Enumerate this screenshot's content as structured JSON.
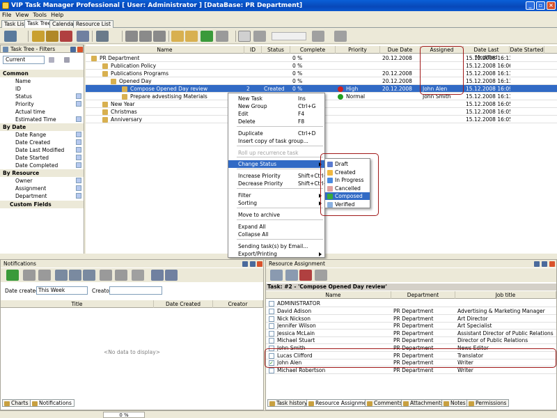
{
  "window": {
    "title": "VIP Task Manager Professional [ User: Administrator ] [DataBase: PR Department]"
  },
  "menu": [
    "File",
    "View",
    "Tools",
    "Help"
  ],
  "main_tabs": [
    "Task List",
    "Task Tree",
    "Calendar",
    "Resource List"
  ],
  "filters": {
    "title": "Task Tree - Filters",
    "current": "Current",
    "sections": [
      {
        "label": "Common",
        "items": [
          "Name",
          "ID",
          "Status",
          "Priority",
          "Actual time",
          "Estimated Time"
        ]
      },
      {
        "label": "By Date",
        "items": [
          "Date Range",
          "Date Created",
          "Date Last Modified",
          "Date Started",
          "Date Completed"
        ]
      },
      {
        "label": "By Resource",
        "items": [
          "Owner",
          "Assignment",
          "Department"
        ]
      }
    ],
    "custom": "Custom Fields"
  },
  "tree": {
    "columns": [
      "Name",
      "ID",
      "Status",
      "Complete",
      "Priority",
      "Due Date",
      "Assigned",
      "Date Last Modified",
      "Date Started"
    ],
    "rows": [
      {
        "name": "PR Department",
        "id": "",
        "status": "",
        "complete": "0 %",
        "priority": "",
        "due": "20.12.2008",
        "assigned": "",
        "modified": "15.12.2008 16:13"
      },
      {
        "name": "Publication Policy",
        "id": "",
        "status": "",
        "complete": "0 %",
        "priority": "",
        "due": "",
        "assigned": "",
        "modified": "15.12.2008 16:06"
      },
      {
        "name": "Publications Programs",
        "id": "",
        "status": "",
        "complete": "0 %",
        "priority": "",
        "due": "20.12.2008",
        "assigned": "",
        "modified": "15.12.2008 16:13"
      },
      {
        "name": "Opened Day",
        "id": "",
        "status": "",
        "complete": "0 %",
        "priority": "",
        "due": "20.12.2008",
        "assigned": "",
        "modified": "15.12.2008 16:13"
      },
      {
        "name": "Compose Opened Day review",
        "id": "2",
        "status": "Created",
        "complete": "0 %",
        "priority": "High",
        "due": "20.12.2008",
        "assigned": "John Alen",
        "modified": "15.12.2008 16:09"
      },
      {
        "name": "Prepare advestising Materials",
        "id": "",
        "status": "",
        "complete": "",
        "priority": "Normal",
        "due": "",
        "assigned": "John Smith",
        "modified": "15.12.2008 16:13"
      },
      {
        "name": "New Year",
        "id": "",
        "status": "",
        "complete": "",
        "priority": "",
        "due": "",
        "assigned": "",
        "modified": "15.12.2008 16:05"
      },
      {
        "name": "Christmas",
        "id": "",
        "status": "",
        "complete": "",
        "priority": "",
        "due": "",
        "assigned": "",
        "modified": "15.12.2008 16:05"
      },
      {
        "name": "Anniversary",
        "id": "",
        "status": "",
        "complete": "",
        "priority": "",
        "due": "",
        "assigned": "",
        "modified": "15.12.2008 16:05"
      }
    ]
  },
  "context_menu": [
    {
      "label": "New Task",
      "key": "Ins"
    },
    {
      "label": "New Group",
      "key": "Ctrl+G"
    },
    {
      "label": "Edit",
      "key": "F4"
    },
    {
      "label": "Delete",
      "key": "F8"
    },
    {
      "label": "Duplicate",
      "key": "Ctrl+D"
    },
    {
      "label": "Insert copy of task group...",
      "key": ""
    },
    {
      "label": "Roll up recurrence task",
      "key": ""
    },
    {
      "label": "Change Status",
      "key": ""
    },
    {
      "label": "Increase Priority",
      "key": "Shift+Ctrl+Up"
    },
    {
      "label": "Decrease Priority",
      "key": "Shift+Ctrl+Down"
    },
    {
      "label": "Filter",
      "key": ""
    },
    {
      "label": "Sorting",
      "key": ""
    },
    {
      "label": "Move to archive",
      "key": ""
    },
    {
      "label": "Expand All",
      "key": ""
    },
    {
      "label": "Collapse All",
      "key": ""
    },
    {
      "label": "Sending task(s) by Email...",
      "key": ""
    },
    {
      "label": "Export/Printing",
      "key": ""
    }
  ],
  "status_menu": [
    "Draft",
    "Created",
    "In Progress",
    "Cancelled",
    "Composed",
    "Verified"
  ],
  "notifications": {
    "title": "Notifications",
    "date_created_label": "Date created:",
    "date_created_value": "This Week",
    "creator_label": "Creator:",
    "columns": [
      "Title",
      "Date Created",
      "Creator"
    ],
    "empty": "<No data to display>",
    "tabs": [
      "Charts",
      "Notifications"
    ]
  },
  "resource": {
    "title": "Resource Assignment",
    "task_header": "Task: #2 - 'Compose Opened Day review'",
    "columns": [
      "Name",
      "Department",
      "Job title"
    ],
    "group": "ADMINISTRATOR",
    "rows": [
      {
        "name": "David Adison",
        "dept": "PR Department",
        "job": "Advertising & Marketing Manager",
        "checked": false
      },
      {
        "name": "Nick Nickson",
        "dept": "PR Department",
        "job": "Art Director",
        "checked": false
      },
      {
        "name": "Jennifer Wilson",
        "dept": "PR Department",
        "job": "Art Specialist",
        "checked": false
      },
      {
        "name": "Jessica McLain",
        "dept": "PR Department",
        "job": "Assistant Director of Public Relations",
        "checked": false
      },
      {
        "name": "Michael Stuart",
        "dept": "PR Department",
        "job": "Director of Public Relations",
        "checked": false
      },
      {
        "name": "John Smith",
        "dept": "PR Department",
        "job": "News Editor",
        "checked": false
      },
      {
        "name": "Lucas Clifford",
        "dept": "PR Department",
        "job": "Translator",
        "checked": false
      },
      {
        "name": "John Alen",
        "dept": "PR Department",
        "job": "Writer",
        "checked": true
      },
      {
        "name": "Michael Robertson",
        "dept": "PR Department",
        "job": "Writer",
        "checked": false
      }
    ],
    "tabs": [
      "Task history",
      "Resource Assignment",
      "Comments",
      "Attachments",
      "Notes",
      "Permissions"
    ]
  },
  "statusbar": {
    "progress": "0 %"
  }
}
